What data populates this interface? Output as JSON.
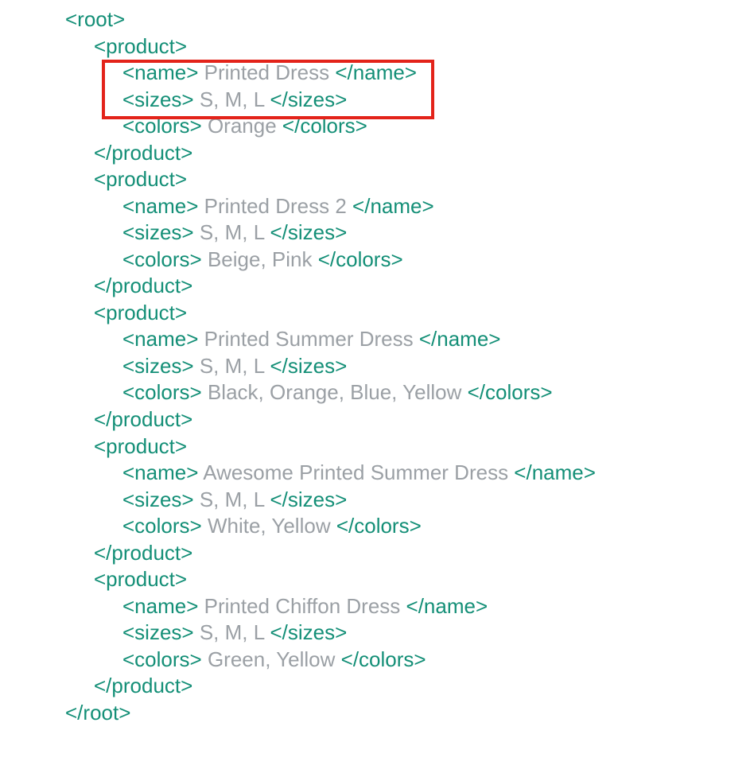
{
  "xml": {
    "rootOpen": "<root>",
    "rootClose": "</root>",
    "productOpen": "<product>",
    "productClose": "</product>",
    "nameOpen": "<name> ",
    "nameClose": " </name>",
    "sizesOpen": "<sizes> ",
    "sizesClose": " </sizes>",
    "colorsOpen": "<colors> ",
    "colorsClose": " </colors>"
  },
  "products": [
    {
      "name": "Printed Dress",
      "sizes": "S, M, L",
      "colors": "Orange"
    },
    {
      "name": "Printed Dress 2",
      "sizes": "S, M, L",
      "colors": "Beige, Pink"
    },
    {
      "name": "Printed Summer Dress",
      "sizes": "S, M, L",
      "colors": "Black, Orange, Blue, Yellow"
    },
    {
      "name": "Awesome Printed Summer Dress",
      "sizes": "S, M, L",
      "colors": "White, Yellow"
    },
    {
      "name": "Printed Chiffon Dress",
      "sizes": "S, M, L",
      "colors": "Green, Yellow"
    }
  ]
}
